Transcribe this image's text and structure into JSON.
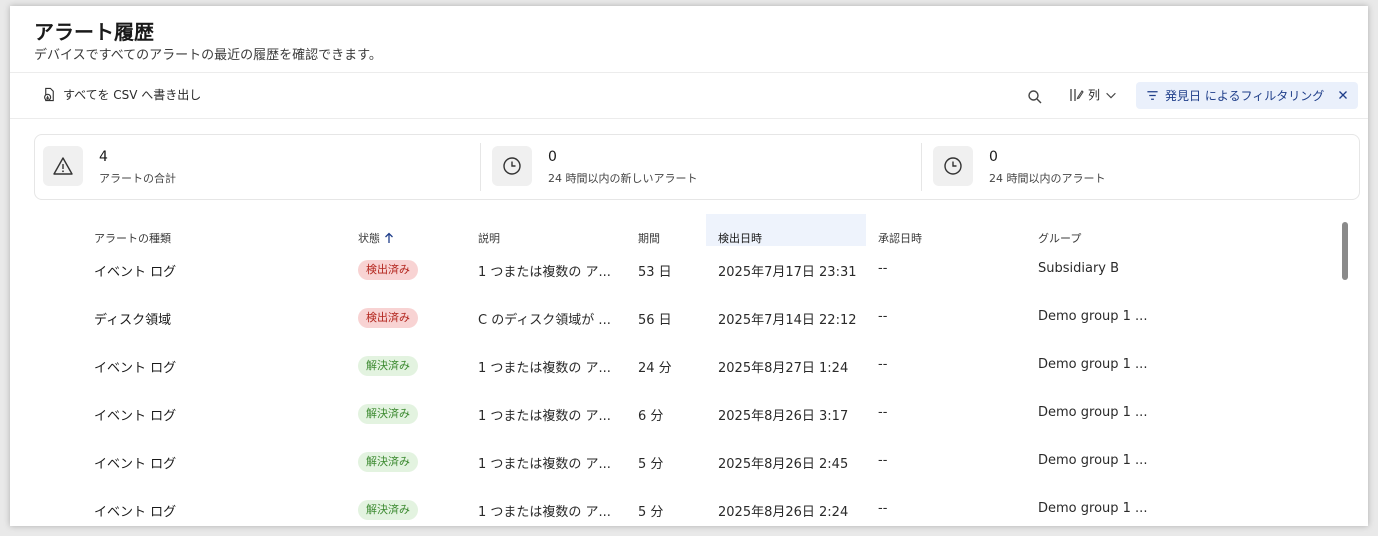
{
  "header": {
    "title": "アラート履歴",
    "subtitle": "デバイスですべてのアラートの最近の履歴を確認できます。"
  },
  "toolbar": {
    "export_label": "すべてを CSV へ書き出し",
    "columns_label": "列",
    "filter_label": "発見日 によるフィルタリング"
  },
  "stats": [
    {
      "value": "4",
      "label": "アラートの合計",
      "icon": "warning-icon"
    },
    {
      "value": "0",
      "label": "24 時間以内の新しいアラート",
      "icon": "clock-icon"
    },
    {
      "value": "0",
      "label": "24 時間以内のアラート",
      "icon": "clock-icon"
    }
  ],
  "table": {
    "headers": [
      "アラートの種類",
      "状態",
      "説明",
      "期間",
      "検出日時",
      "承認日時",
      "グループ"
    ],
    "sorted_column": "状態",
    "active_column": "検出日時",
    "rows": [
      {
        "type": "イベント ログ",
        "status": "検出済み",
        "status_kind": "detected",
        "description": "1 つまたは複数の ア...",
        "duration": "53 日",
        "detected": "2025年7月17日 23:31",
        "approved": "--",
        "group": "Subsidiary B"
      },
      {
        "type": "ディスク領域",
        "status": "検出済み",
        "status_kind": "detected",
        "description": "C のディスク領域が ...",
        "duration": "56 日",
        "detected": "2025年7月14日 22:12",
        "approved": "--",
        "group": "Demo group 1 ..."
      },
      {
        "type": "イベント ログ",
        "status": "解決済み",
        "status_kind": "resolved",
        "description": "1 つまたは複数の ア...",
        "duration": "24 分",
        "detected": "2025年8月27日 1:24",
        "approved": "--",
        "group": "Demo group 1 ..."
      },
      {
        "type": "イベント ログ",
        "status": "解決済み",
        "status_kind": "resolved",
        "description": "1 つまたは複数の ア...",
        "duration": "6 分",
        "detected": "2025年8月26日 3:17",
        "approved": "--",
        "group": "Demo group 1 ..."
      },
      {
        "type": "イベント ログ",
        "status": "解決済み",
        "status_kind": "resolved",
        "description": "1 つまたは複数の ア...",
        "duration": "5 分",
        "detected": "2025年8月26日 2:45",
        "approved": "--",
        "group": "Demo group 1 ..."
      },
      {
        "type": "イベント ログ",
        "status": "解決済み",
        "status_kind": "resolved",
        "description": "1 つまたは複数の ア...",
        "duration": "5 分",
        "detected": "2025年8月26日 2:24",
        "approved": "--",
        "group": "Demo group 1 ..."
      }
    ]
  },
  "colors": {
    "accent": "#1f3e8a",
    "detected_bg": "#f8d3d3",
    "detected_fg": "#b3261e",
    "resolved_bg": "#e3f3e0",
    "resolved_fg": "#3c8a30"
  }
}
